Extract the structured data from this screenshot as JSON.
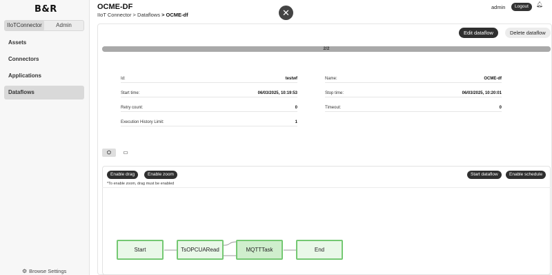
{
  "sidebar": {
    "logo": "B&R",
    "tabs": [
      "IIoTConnector",
      "Admin"
    ],
    "items": [
      {
        "label": "Assets"
      },
      {
        "label": "Connectors"
      },
      {
        "label": "Applications"
      },
      {
        "label": "Dataflows"
      }
    ],
    "browse_settings": "Browse Settings"
  },
  "header": {
    "title": "OCME-DF",
    "breadcrumb": [
      "IIoT Connector >",
      "Dataflows",
      "> OCME-df"
    ],
    "user": "admin",
    "logout": "Logout"
  },
  "actions": {
    "edit": "Edit dataflow",
    "delete": "Delete dataflow"
  },
  "progress": {
    "text": "2/2",
    "value": 1.0
  },
  "details": {
    "id_label": "Id:",
    "id_value": "testwf",
    "name_label": "Name:",
    "name_value": "OCME-df",
    "start_label": "Start time:",
    "start_value": "06/03/2025, 10:19:53",
    "stop_label": "Stop time:",
    "stop_value": "06/03/2025, 10:20:01",
    "retry_label": "Retry count:",
    "retry_value": "0",
    "timeout_label": "Timeout:",
    "timeout_value": "0",
    "history_label": "Execution History Limit:",
    "history_value": "1"
  },
  "flow": {
    "enable_drag": "Enable drag",
    "enable_zoom": "Enable zoom",
    "note": "*To enable zoom, drag must be enabled",
    "start_dataflow": "Start dataflow",
    "enable_schedule": "Enable schedule",
    "nodes": [
      "Start",
      "TsOPCUARead",
      "MQTTTask",
      "End"
    ]
  },
  "colors": {
    "node_border": "#74c872",
    "node_fill": "#e9f8e8",
    "button_dark": "#2f2f2f"
  }
}
